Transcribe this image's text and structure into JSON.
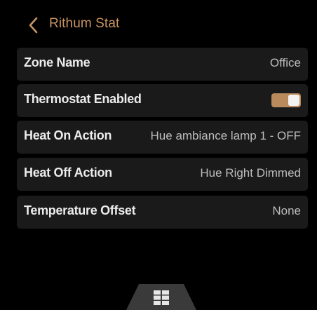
{
  "header": {
    "title": "Rithum Stat",
    "back_icon": "chevron-left-icon"
  },
  "settings": {
    "zone_name": {
      "label": "Zone Name",
      "value": "Office"
    },
    "thermostat_enabled": {
      "label": "Thermostat Enabled",
      "enabled": true
    },
    "heat_on_action": {
      "label": "Heat On Action",
      "value": "Hue ambiance lamp 1 - OFF"
    },
    "heat_off_action": {
      "label": "Heat Off Action",
      "value": "Hue Right Dimmed"
    },
    "temperature_offset": {
      "label": "Temperature Offset",
      "value": "None"
    }
  },
  "bottom_nav": {
    "icon": "grid-menu-icon"
  },
  "colors": {
    "accent": "#c89564",
    "toggle_on": "#b98a5b",
    "row_bg": "#1a1a1a",
    "background": "#000000"
  }
}
